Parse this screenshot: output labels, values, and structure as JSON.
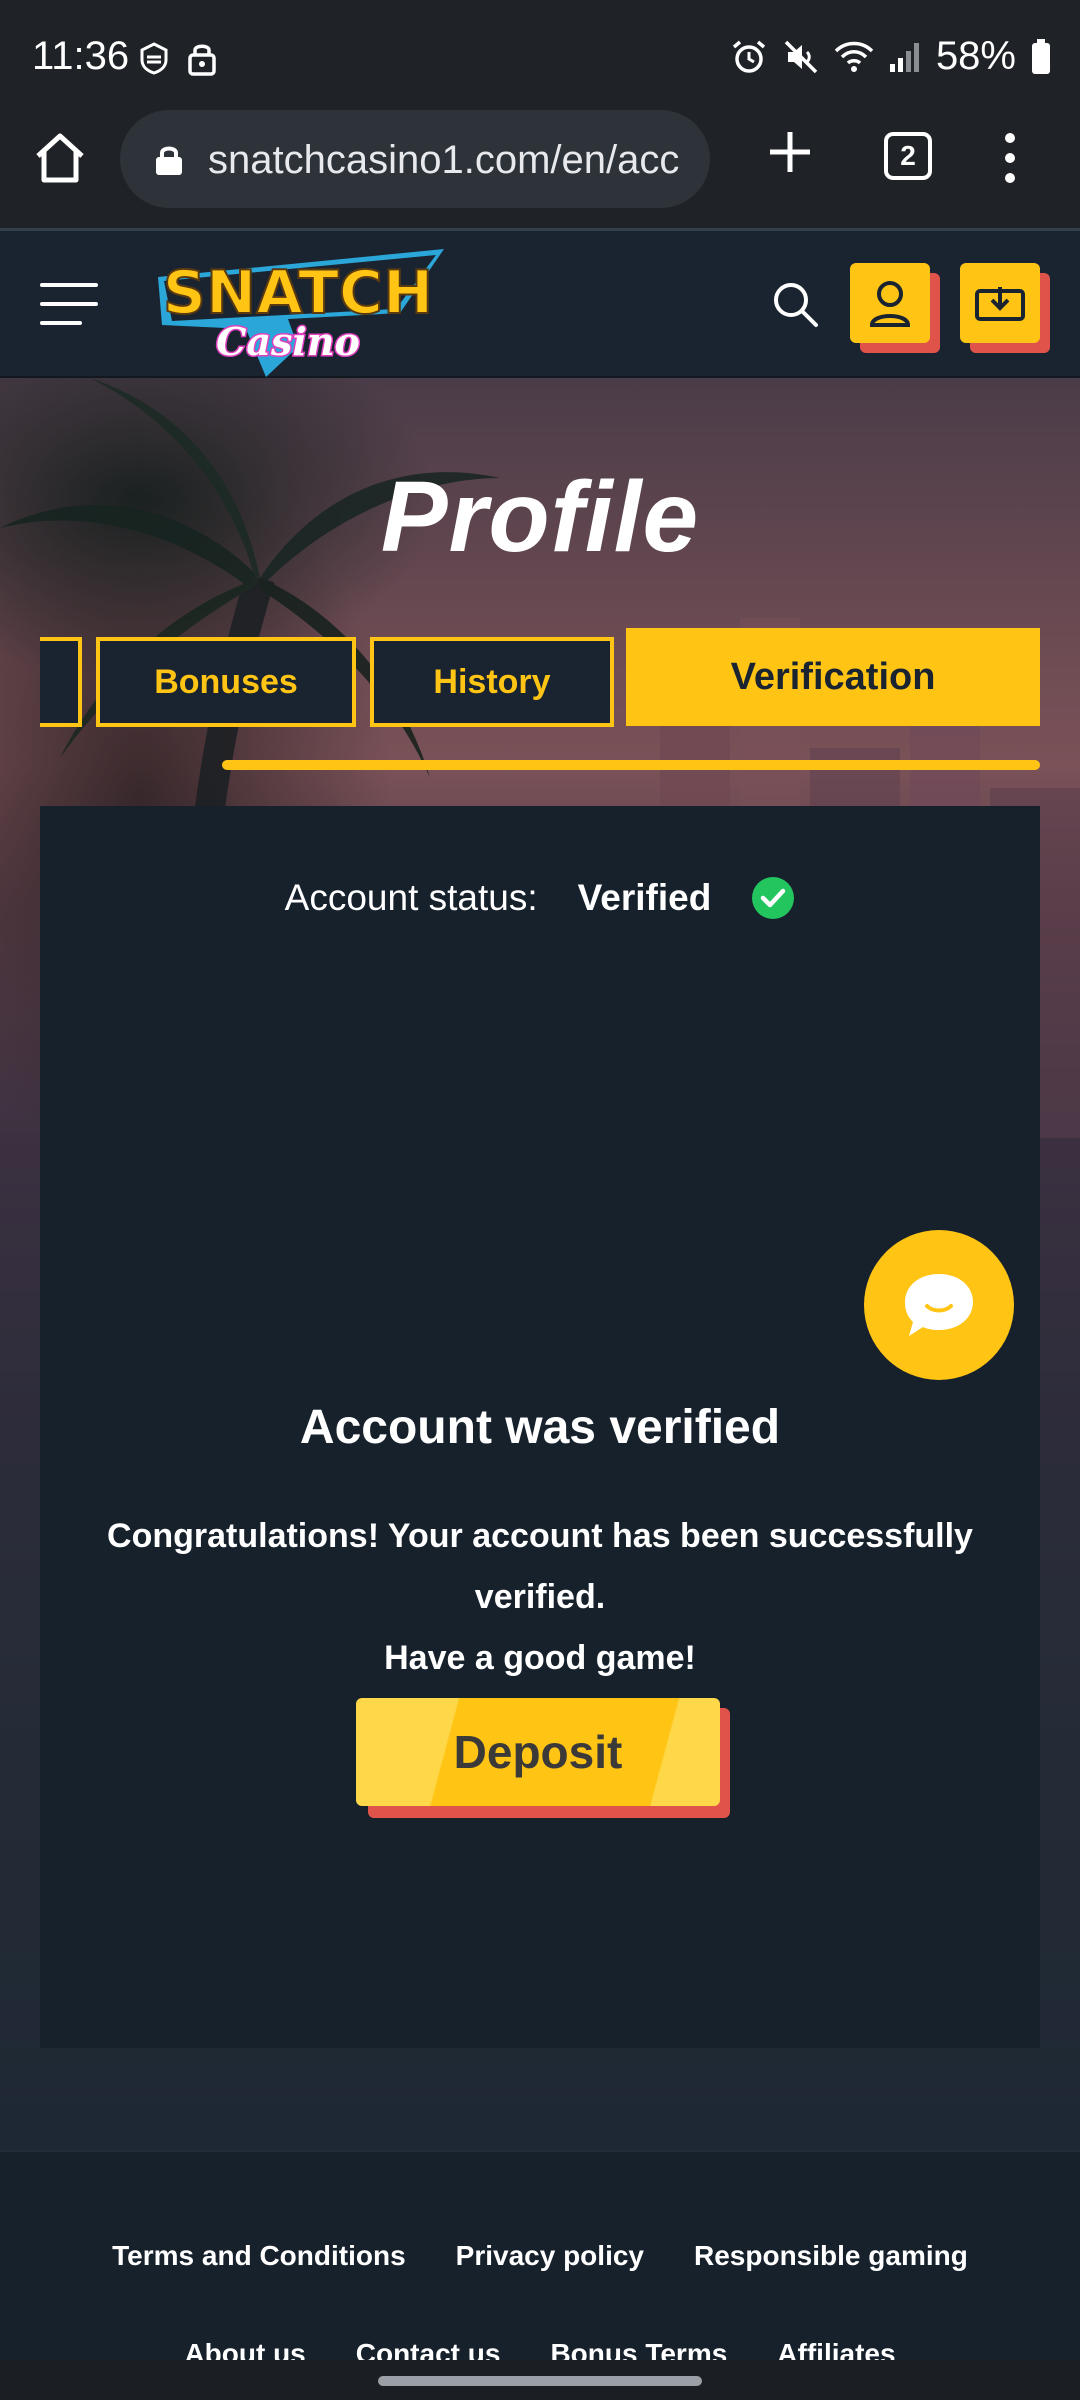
{
  "status_bar": {
    "time": "11:36",
    "battery": "58%",
    "icons": [
      "authenticator-icon",
      "lock-icon",
      "alarm-icon",
      "mute-icon",
      "wifi-icon",
      "signal-icon",
      "battery-icon"
    ]
  },
  "browser": {
    "url": "snatchcasino1.com/en/acc",
    "tab_count": "2"
  },
  "header": {
    "logo_line1": "SNATCH",
    "logo_line2": "Casino"
  },
  "page": {
    "title": "Profile",
    "tabs": [
      {
        "label": ""
      },
      {
        "label": "Bonuses"
      },
      {
        "label": "History"
      },
      {
        "label": "Verification",
        "active": true
      }
    ]
  },
  "account": {
    "status_label": "Account status:",
    "status_value": "Verified",
    "verified_title": "Account was verified",
    "message_line1": "Congratulations! Your account has been successfully verified.",
    "message_line2": "Have a good game!",
    "deposit_label": "Deposit"
  },
  "footer": {
    "links_row1": [
      "Terms and Conditions",
      "Privacy policy",
      "Responsible gaming"
    ],
    "links_row2": [
      "About us",
      "Contact us",
      "Bonus Terms",
      "Affiliates"
    ]
  },
  "colors": {
    "accent": "#ffc414",
    "accent_shadow": "#e0534a",
    "panel": "#17212c",
    "header": "#1a2430",
    "success": "#22c55e"
  }
}
